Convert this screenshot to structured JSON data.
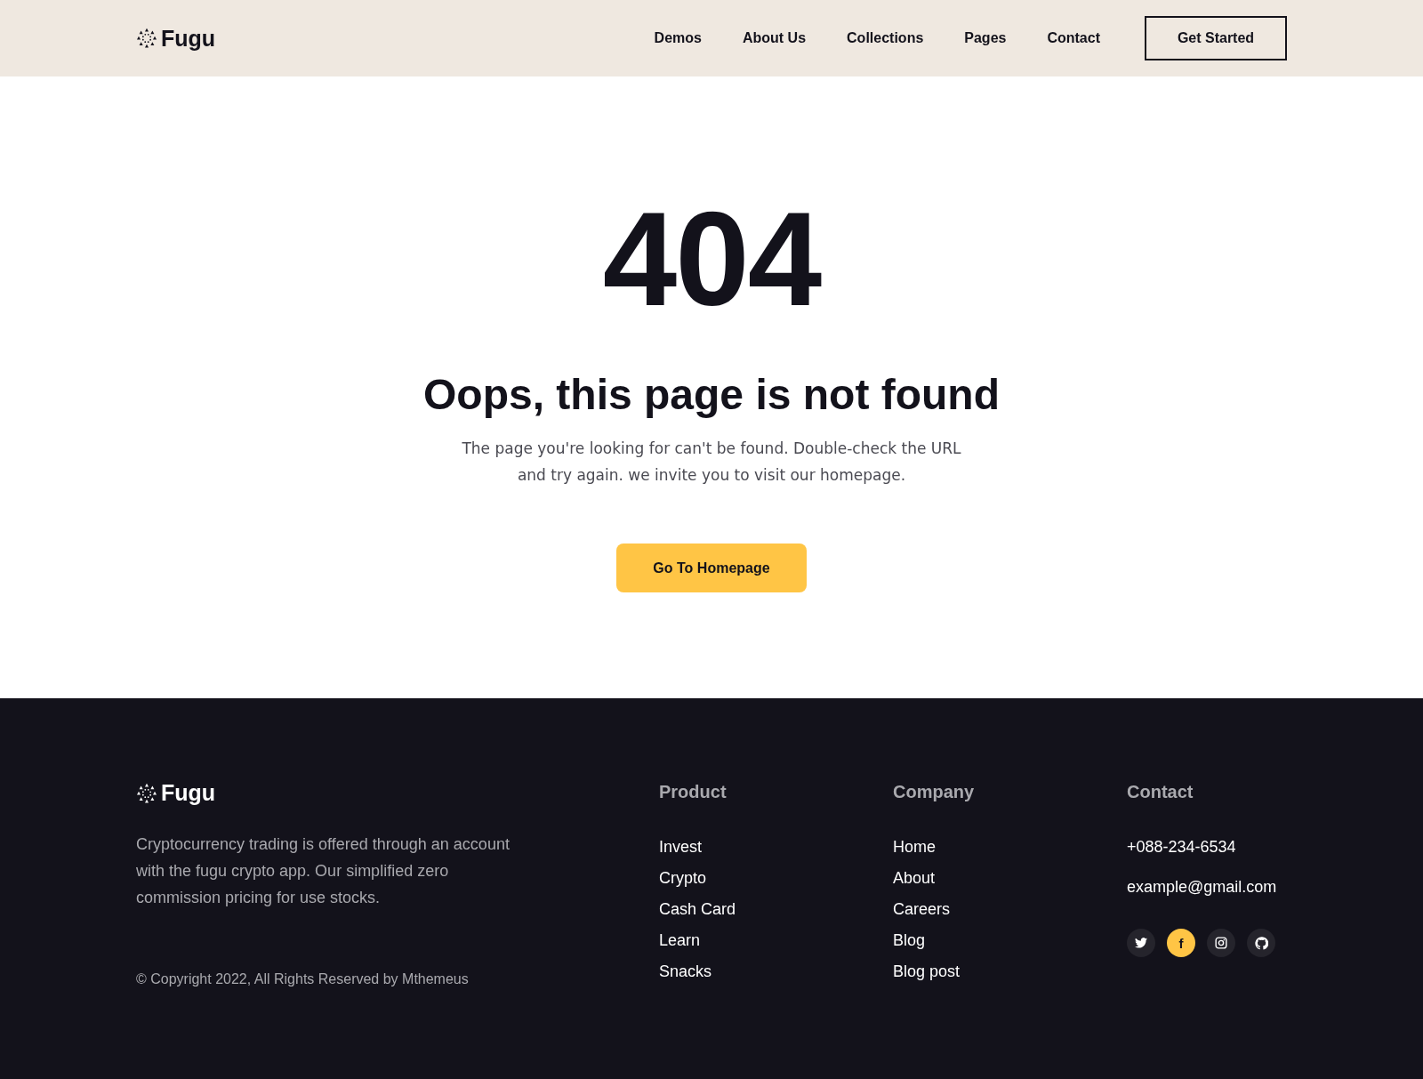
{
  "header": {
    "logo": "Fugu",
    "nav": [
      {
        "label": "Demos"
      },
      {
        "label": "About Us"
      },
      {
        "label": "Collections"
      },
      {
        "label": "Pages"
      },
      {
        "label": "Contact"
      }
    ],
    "cta": "Get Started"
  },
  "hero": {
    "code": "404",
    "title": "Oops, this page is not found",
    "text": "The page you're looking for can't be found. Double-check the URL and try again. we invite you to visit our homepage.",
    "button": "Go To Homepage"
  },
  "footer": {
    "logo": "Fugu",
    "about": "Cryptocurrency trading is offered through an account with the fugu crypto app. Our simplified zero commission pricing for use stocks.",
    "copyright": "© Copyright 2022, All Rights Reserved by Mthemeus",
    "columns": [
      {
        "title": "Product",
        "links": [
          "Invest",
          "Crypto",
          "Cash Card",
          "Learn",
          "Snacks"
        ]
      },
      {
        "title": "Company",
        "links": [
          "Home",
          "About",
          "Careers",
          "Blog",
          "Blog post"
        ]
      }
    ],
    "contact": {
      "title": "Contact",
      "phone": "+088-234-6534",
      "email": "example@gmail.com"
    },
    "social": [
      {
        "kind": "bird",
        "selected": false
      },
      {
        "kind": "text",
        "label": "f",
        "selected": true
      },
      {
        "kind": "camera",
        "selected": false
      },
      {
        "kind": "cat",
        "selected": false
      }
    ]
  }
}
